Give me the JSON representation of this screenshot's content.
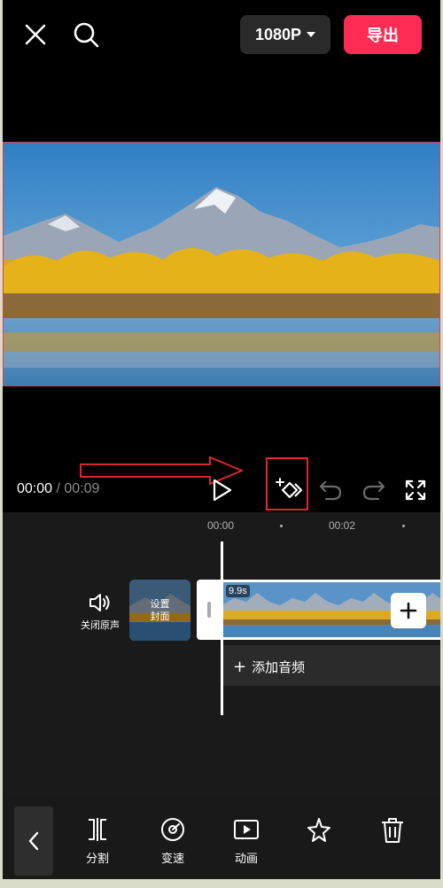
{
  "topbar": {
    "close_icon": "close-icon",
    "search_icon": "search-icon",
    "resolution": "1080P",
    "export_label": "导出",
    "export_color": "#fe2c55"
  },
  "player": {
    "current_time": "00:00",
    "separator": "/",
    "duration": "00:09"
  },
  "timeline": {
    "ruler": [
      "00:00",
      "00:02"
    ],
    "mute_label": "关闭原声",
    "cover_line1": "设置",
    "cover_line2": "封面",
    "clip_duration": "9.9s",
    "add_audio": "添加音频"
  },
  "toolbar": {
    "items": [
      {
        "label": "分割",
        "icon": "split-icon"
      },
      {
        "label": "变速",
        "icon": "speed-icon"
      },
      {
        "label": "动画",
        "icon": "animation-icon"
      },
      {
        "label": "",
        "icon": "effects-icon"
      },
      {
        "label": "",
        "icon": "delete-icon"
      }
    ]
  }
}
